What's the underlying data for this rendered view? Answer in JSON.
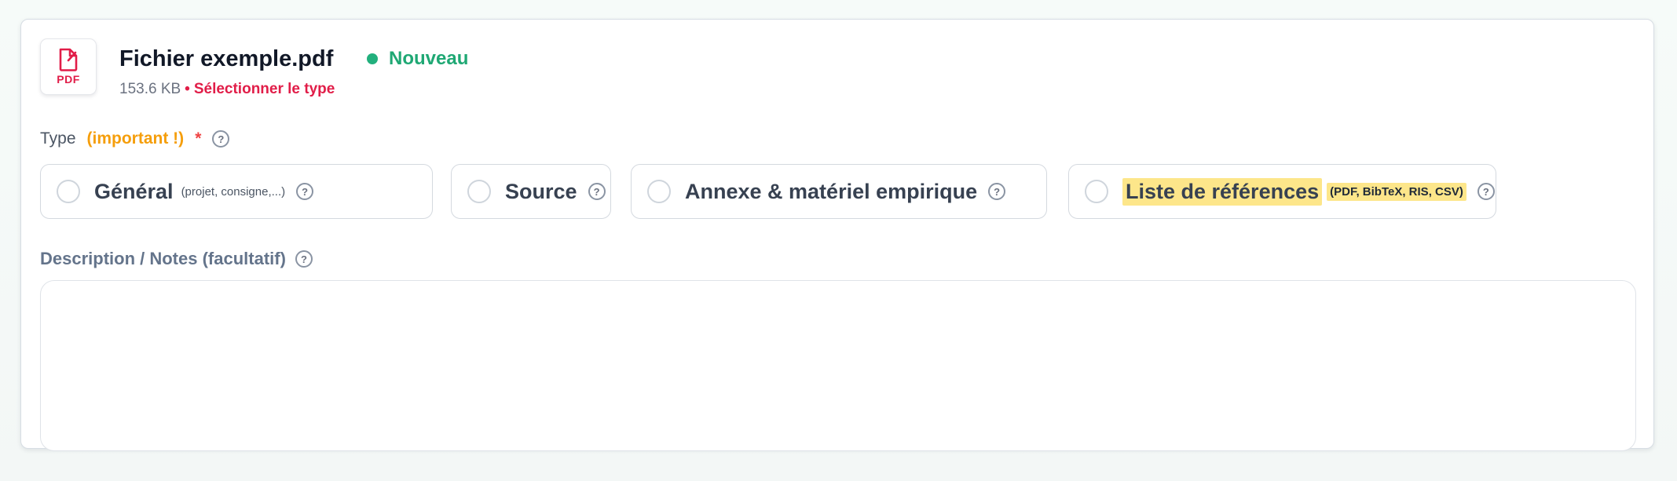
{
  "file": {
    "icon_name": "pdf-file-icon",
    "icon_text": "PDF",
    "name": "Fichier exemple.pdf",
    "status": "Nouveau",
    "size": "153.6 KB",
    "separator": "•",
    "select_type_text": "Sélectionner le type"
  },
  "type_field": {
    "label": "Type",
    "important": "(important !)",
    "required_mark": "*",
    "help_glyph": "?"
  },
  "type_options": [
    {
      "label": "Général",
      "hint": "(projet, consigne,...)",
      "selected": false,
      "highlighted": false
    },
    {
      "label": "Source",
      "hint": "",
      "selected": false,
      "highlighted": false
    },
    {
      "label": "Annexe & matériel empirique",
      "hint": "",
      "selected": false,
      "highlighted": false
    },
    {
      "label": "Liste de références",
      "hint": "(PDF, BibTeX, RIS, CSV)",
      "selected": false,
      "highlighted": true
    }
  ],
  "description": {
    "label": "Description / Notes (facultatif)",
    "value": "",
    "placeholder": ""
  },
  "colors": {
    "accent_red": "#e11d48",
    "status_green": "#22b07d",
    "important_orange": "#f59e0b",
    "highlight_yellow": "#fde68a"
  }
}
